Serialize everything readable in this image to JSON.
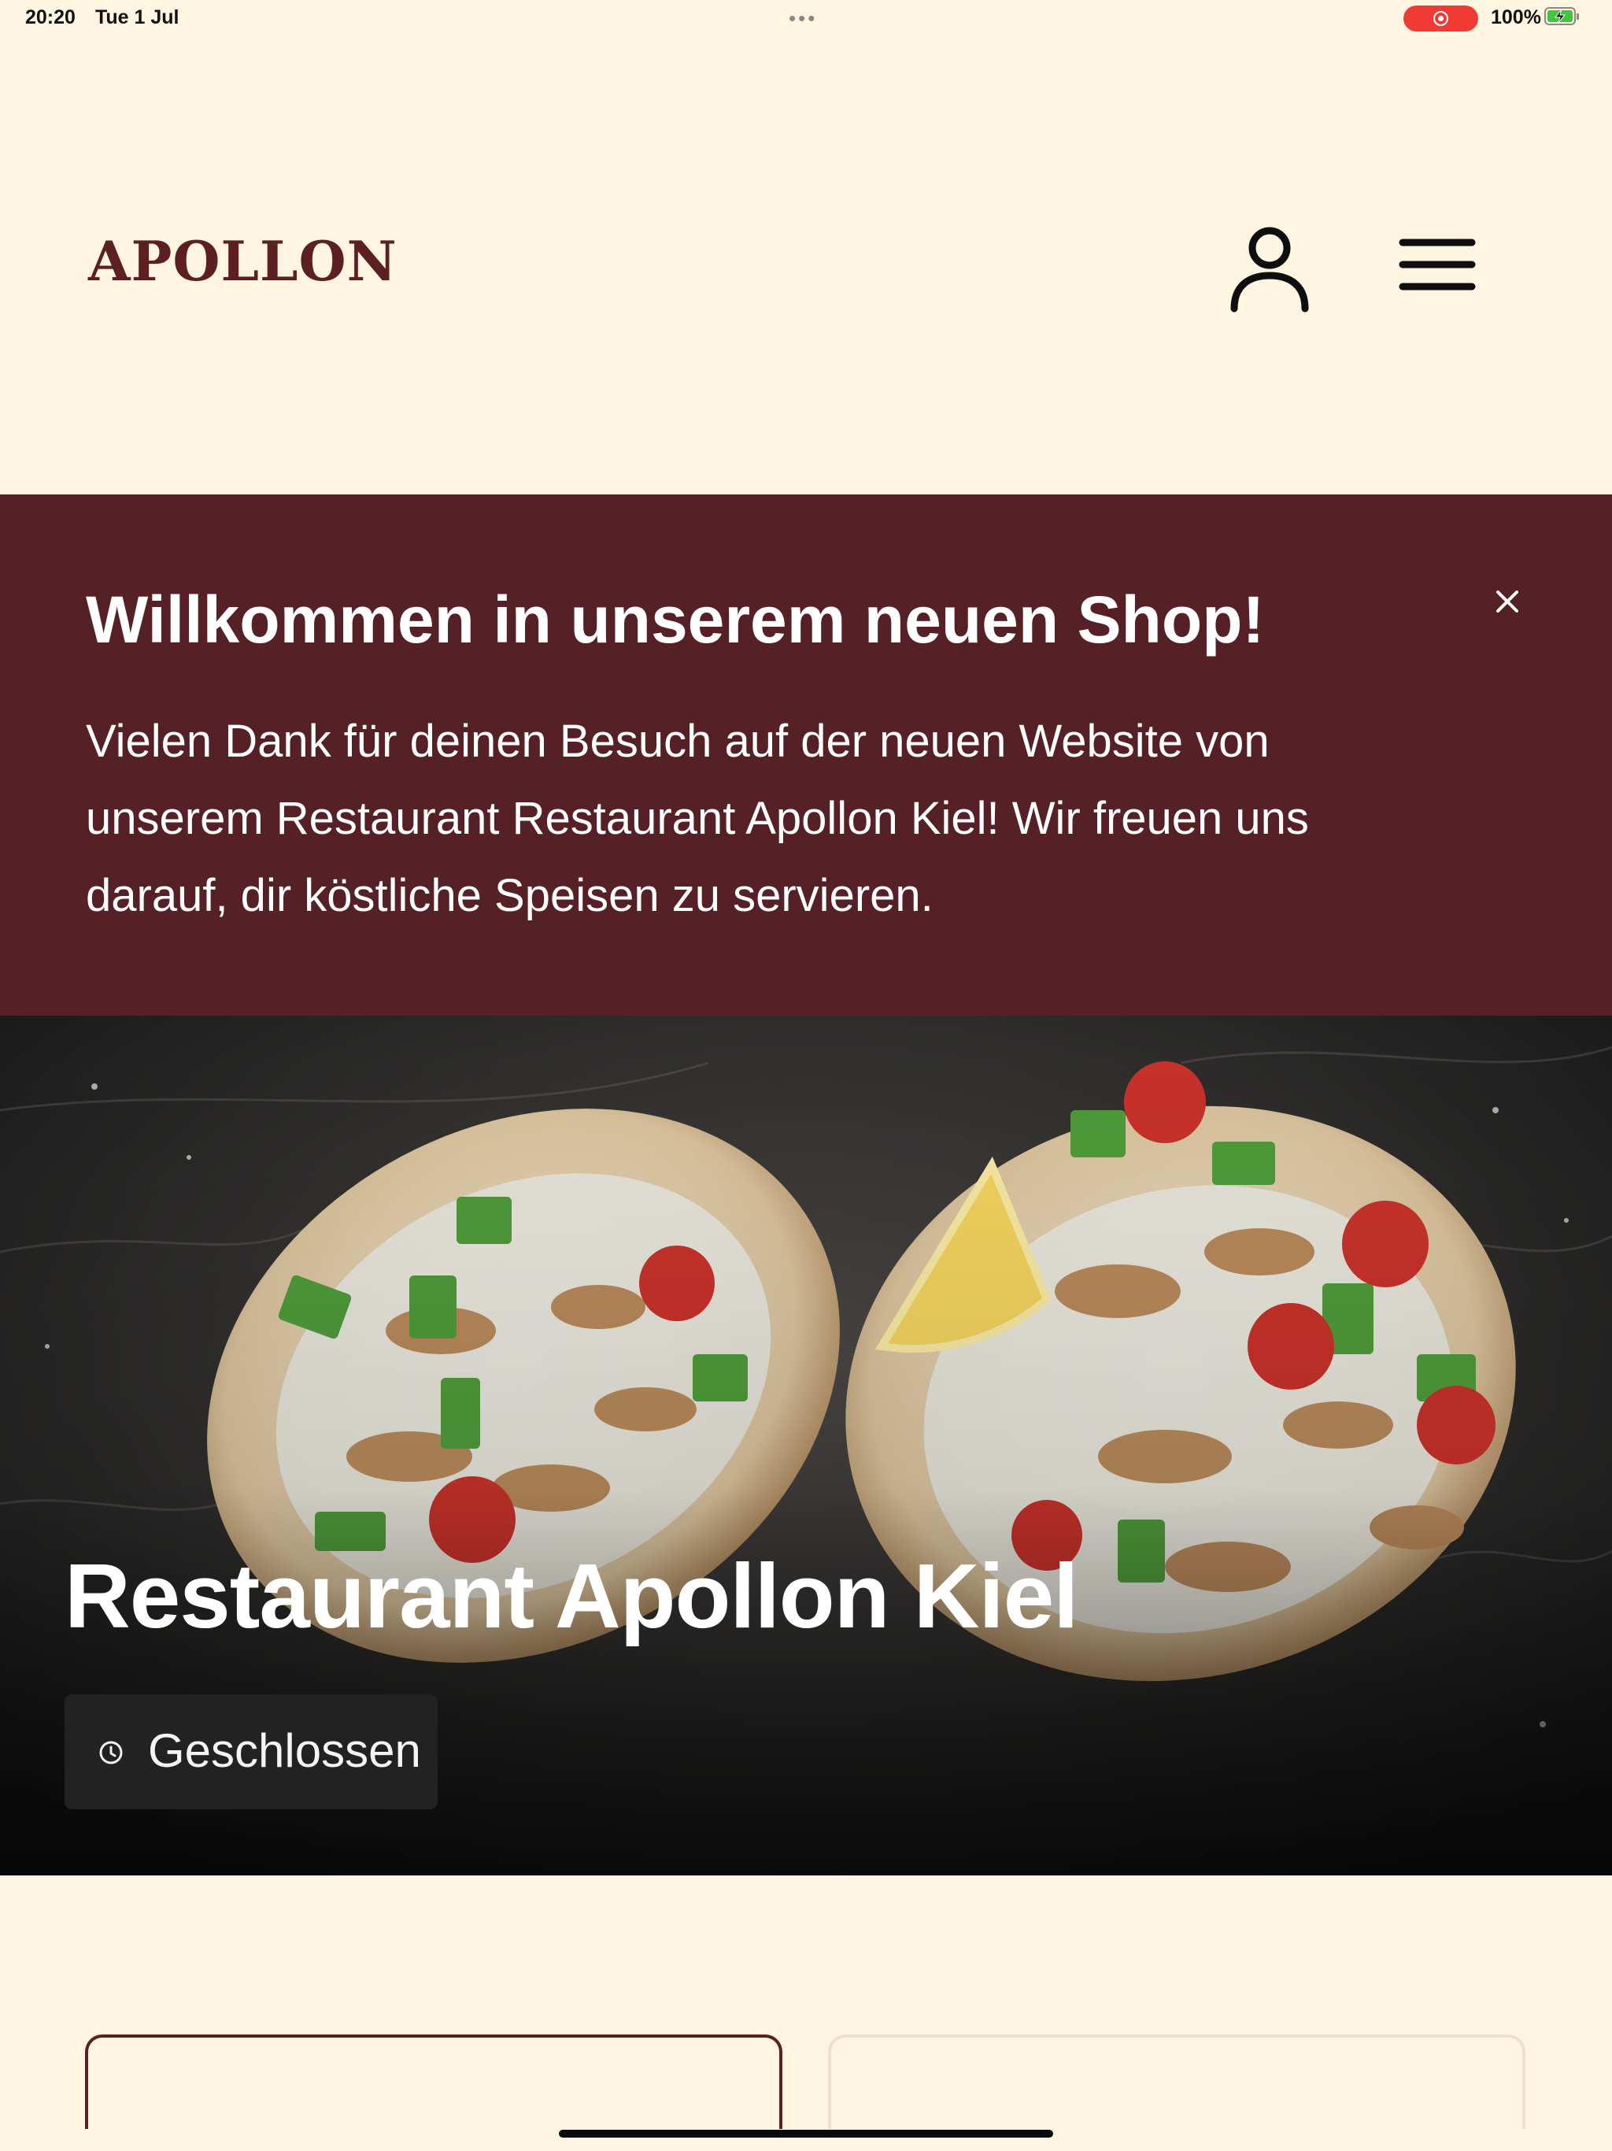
{
  "status_bar": {
    "time": "20:20",
    "date": "Tue 1 Jul",
    "dots": "•••",
    "battery": "100%"
  },
  "header": {
    "logo": "APOLLON",
    "account_icon": "user-icon",
    "menu_icon": "hamburger-menu-icon"
  },
  "welcome": {
    "title": "Willkommen in unserem neuen Shop!",
    "text": "Vielen Dank für deinen Besuch auf der neuen Website von unserem Restaurant Restaurant Apollon Kiel! Wir freuen uns darauf, dir köstliche Speisen zu servieren.",
    "close_icon": "close-icon"
  },
  "hero": {
    "title": "Restaurant Apollon Kiel",
    "status_label": "Geschlossen",
    "status_icon": "clock-icon"
  },
  "colors": {
    "background": "#fff5e1",
    "brand": "#562126",
    "logo": "#5b1f24"
  }
}
